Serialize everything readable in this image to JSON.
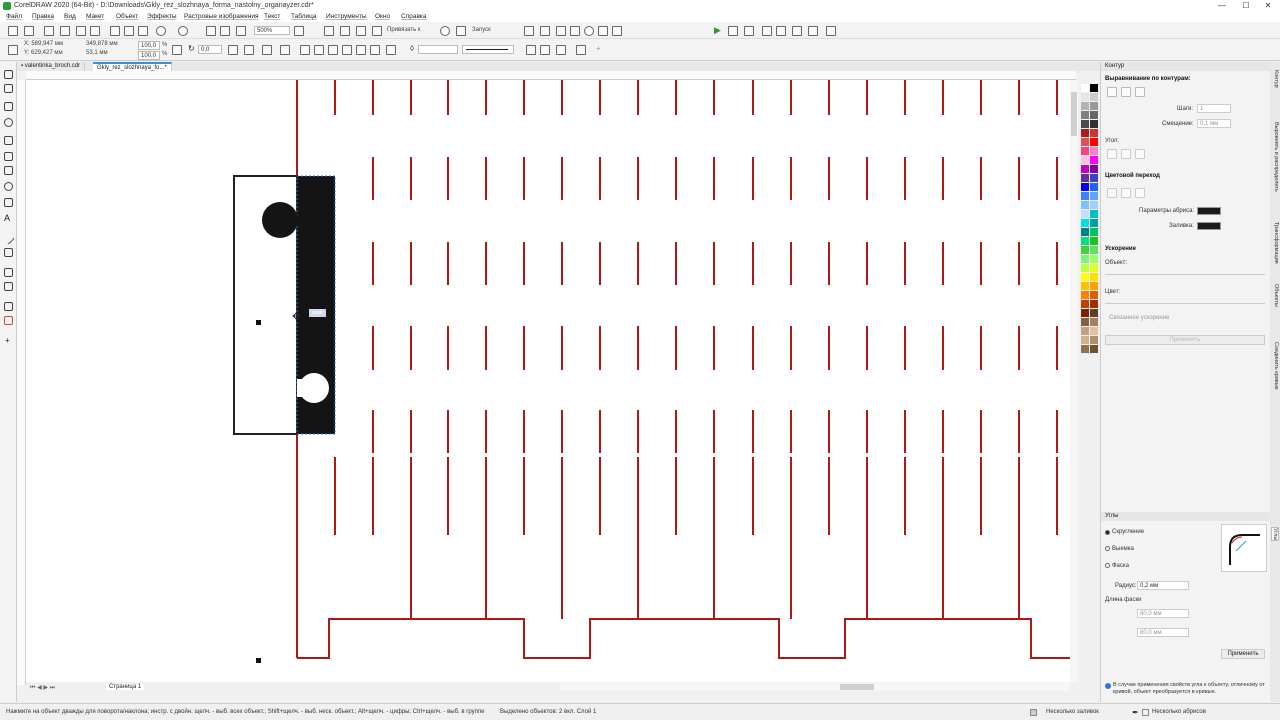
{
  "app": {
    "title": "CorelDRAW 2020 (64-Bit) - D:\\Downloads\\Gkly_rez_slozhnaya_forma_nastolny_organayzer.cdr*",
    "window_controls": [
      "—",
      "☐",
      "✕"
    ]
  },
  "menu": [
    "Файл",
    "Правка",
    "Вид",
    "Макет",
    "Объект",
    "Эффекты",
    "Растровые изображения",
    "Текст",
    "Таблица",
    "Инструменты",
    "Окно",
    "Справка"
  ],
  "toolbar1": {
    "zoom": "500%",
    "snap_label": "Привязать к",
    "launch_label": "Запуск"
  },
  "toolbar2": {
    "x": "X: 589,947 мм",
    "y": "Y: 629,427 мм",
    "width": "349,878 мм",
    "height": "53,1 мм",
    "scale_x": "100,0",
    "scale_y": "100,0",
    "pct": "%",
    "angle": "0,0",
    "outline_width": ""
  },
  "doc_tabs": [
    "valentinka_broch.cdr",
    "Gkly_rez_slozhnaya_fo...*"
  ],
  "canvas": {
    "tooltip": "край",
    "cursor": "✥"
  },
  "page_bar": {
    "page_label": "Страница 1"
  },
  "palette_colors": [
    "#ffffff",
    "#000000",
    "#e6e6e6",
    "#cccccc",
    "#b3b3b3",
    "#999999",
    "#808080",
    "#666666",
    "#4d4d4d",
    "#333333",
    "#b31b1b",
    "#cc3333",
    "#e05050",
    "#ff0000",
    "#ff4080",
    "#ff80c0",
    "#ffc0e0",
    "#ff00ff",
    "#c000c0",
    "#8000a0",
    "#6030a0",
    "#4040c0",
    "#0000ff",
    "#2060ff",
    "#4080ff",
    "#60a0ff",
    "#80c0ff",
    "#a0d0ff",
    "#c0e0ff",
    "#00c0c0",
    "#00e0e0",
    "#00a0a0",
    "#008080",
    "#00c060",
    "#00e080",
    "#20c020",
    "#40d040",
    "#60e060",
    "#80f080",
    "#a0ff60",
    "#c0ff40",
    "#e0ff20",
    "#ffff00",
    "#ffe000",
    "#ffc000",
    "#ffa000",
    "#ff8000",
    "#e06000",
    "#c04000",
    "#a03000",
    "#802000",
    "#604020",
    "#806040",
    "#a08060",
    "#c0a080",
    "#e0c0a0",
    "#d0b090",
    "#b09070",
    "#907050",
    "#705030"
  ],
  "docker": {
    "header": "Контур",
    "align_title": "Выравнивание по контурам:",
    "steps_label": "Шаги:",
    "steps_value": "1",
    "offset_label": "Смещение:",
    "offset_value": "0,1 мм",
    "angle_label": "Угол:",
    "blend_title": "Цветовой переход",
    "outline_params_label": "Параметры абриса:",
    "fill_label": "Заливка:",
    "accel_title": "Ускорение",
    "object_label": "Объект:",
    "color_label": "Цвет:",
    "accel_checkbox": "Связанное ускорение",
    "apply_dim": "Применить",
    "corners_header": "Углы",
    "corner_options": [
      "Скругление",
      "Выемка",
      "Фаска"
    ],
    "radius_label": "Радиус:",
    "radius_value": "0,2 мм",
    "chamfer_label": "Длина фаски",
    "chamfer_a": "80,0 мм",
    "chamfer_b": "80,0 мм",
    "apply_button": "Применить",
    "info_text": "В случае применения свойств угла к объекту, отличному от кривой, объект преобразуется в кривые."
  },
  "side_tabs": [
    "Контур",
    "Выровнять и распределить",
    "Трансформация",
    "Объекты",
    "Соединить кривые",
    "Углы"
  ],
  "status": {
    "hint": "Нажмите на объект дважды для поворота/наклона; инстр. с двойн. щелч. - выб. всех объект.; Shift+щелч. - выб. неск. объект.; Alt+щелч. - цифры; Ctrl+щелч. - выб. в группе",
    "selection": "Выделено объектов: 2 вкл. Слой 1",
    "fill_state": "Несколько заливок",
    "outline_state": "Несколько абрисов"
  }
}
